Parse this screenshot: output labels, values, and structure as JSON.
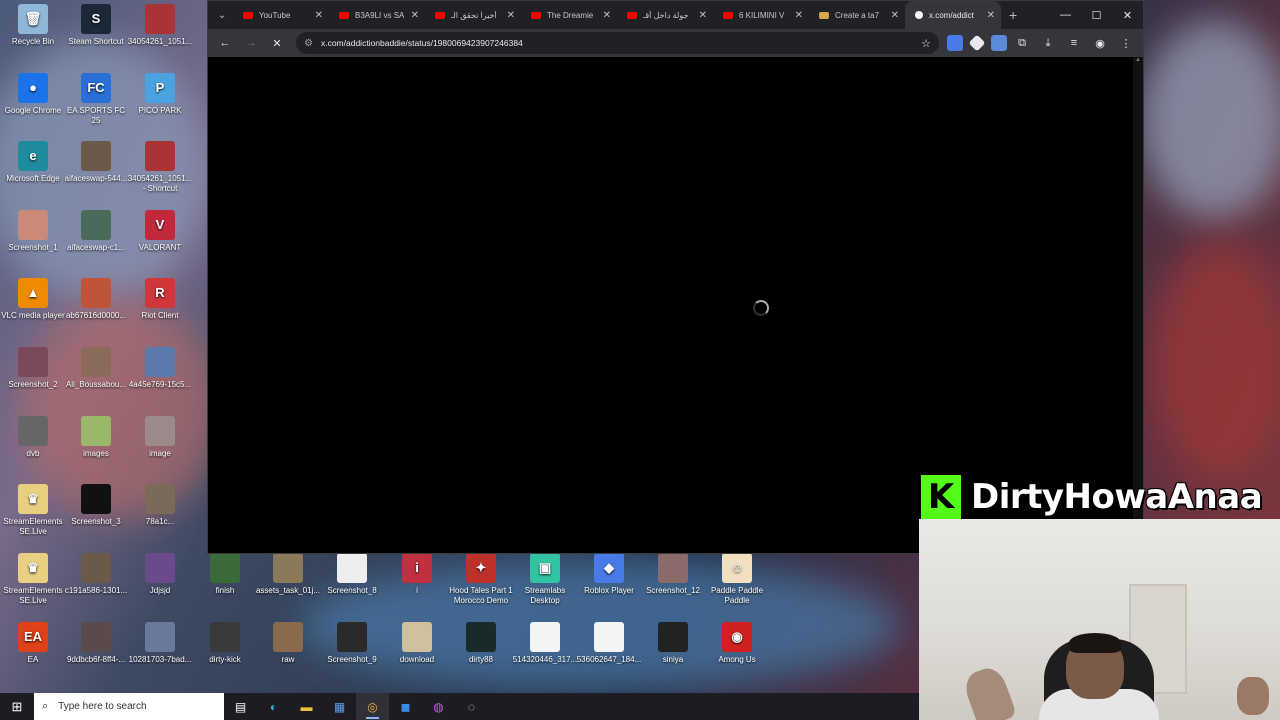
{
  "browser": {
    "tabs": [
      {
        "title": "YouTube",
        "favicon": "youtube-icon"
      },
      {
        "title": "B3A9LI vs SA",
        "favicon": "youtube-icon"
      },
      {
        "title": "أخيراً تحقق الـ",
        "favicon": "youtube-icon"
      },
      {
        "title": "The Dreamie",
        "favicon": "youtube-icon"
      },
      {
        "title": "جولة داخل أقـ",
        "favicon": "youtube-icon"
      },
      {
        "title": "6 KILIMINI V",
        "favicon": "youtube-icon"
      },
      {
        "title": "Create a ta7",
        "favicon": "generic-icon"
      },
      {
        "title": "x.com/addict",
        "favicon": "x-icon",
        "active": true
      }
    ],
    "url": "x.com/addictionbaddie/status/1980069423907246384"
  },
  "desktop_icons": [
    {
      "label": "Recycle Bin",
      "color": "#8fb7d8",
      "glyph": "🗑"
    },
    {
      "label": "Steam Shortcut",
      "color": "#1b2838",
      "glyph": "S"
    },
    {
      "label": "34054261_1051...",
      "color": "#a33",
      "glyph": ""
    },
    {
      "label": "Google Chrome",
      "color": "#1a73e8",
      "glyph": "●"
    },
    {
      "label": "EA SPORTS FC 25",
      "color": "#2a6fd8",
      "glyph": "FC"
    },
    {
      "label": "PICO PARK",
      "color": "#4aa3df",
      "glyph": "P"
    },
    {
      "label": "Microsoft Edge",
      "color": "#1e8c9e",
      "glyph": "e"
    },
    {
      "label": "aifaceswap-544...",
      "color": "#6b5a4a",
      "glyph": ""
    },
    {
      "label": "34054261_1051... - Shortcut",
      "color": "#a33",
      "glyph": ""
    },
    {
      "label": "Screenshot_1",
      "color": "#c98a7a",
      "glyph": ""
    },
    {
      "label": "aifaceswap-c1...",
      "color": "#4a6a5a",
      "glyph": ""
    },
    {
      "label": "VALORANT",
      "color": "#c2283b",
      "glyph": "V"
    },
    {
      "label": "VLC media player",
      "color": "#f08a00",
      "glyph": "▲"
    },
    {
      "label": "ab67616d0000...",
      "color": "#c0543a",
      "glyph": ""
    },
    {
      "label": "Riot Client",
      "color": "#d1363a",
      "glyph": "R"
    },
    {
      "label": "Screenshot_2",
      "color": "#7a4a5a",
      "glyph": ""
    },
    {
      "label": "Ali_Boussabou...",
      "color": "#8a6a5a",
      "glyph": ""
    },
    {
      "label": "4a45e769-15c5...",
      "color": "#5a7aaa",
      "glyph": ""
    },
    {
      "label": "dvb",
      "color": "#666",
      "glyph": ""
    },
    {
      "label": "images",
      "color": "#9ab86a",
      "glyph": ""
    },
    {
      "label": "image",
      "color": "#9a8a8a",
      "glyph": ""
    },
    {
      "label": "StreamElements SE.Live",
      "color": "#e8d080",
      "glyph": "♛"
    },
    {
      "label": "Screenshot_3",
      "color": "#111",
      "glyph": ""
    },
    {
      "label": "78a1c...",
      "color": "#7a6a5a",
      "glyph": ""
    },
    {
      "label": "StreamElements SE.Live",
      "color": "#e8d080",
      "glyph": "♛"
    },
    {
      "label": "c191a586-1301...",
      "color": "#6a5a4a",
      "glyph": ""
    },
    {
      "label": "Jdjsjd",
      "color": "#6a4a8a",
      "glyph": ""
    },
    {
      "label": "finish",
      "color": "#3a6a3a",
      "glyph": ""
    },
    {
      "label": "assets_task_01j...",
      "color": "#8a7a5a",
      "glyph": ""
    },
    {
      "label": "Screenshot_8",
      "color": "#eee",
      "glyph": ""
    },
    {
      "label": "i",
      "color": "#c03040",
      "glyph": "i"
    },
    {
      "label": "Hood Tales Part 1 Morocco Demo",
      "color": "#c0302a",
      "glyph": "✦"
    },
    {
      "label": "Streamlabs Desktop",
      "color": "#31c3a2",
      "glyph": "▣"
    },
    {
      "label": "Roblox Player",
      "color": "#4a7ae8",
      "glyph": "◆"
    },
    {
      "label": "Screenshot_12",
      "color": "#8a6a6a",
      "glyph": ""
    },
    {
      "label": "Paddle Paddle Paddle",
      "color": "#f0e0c0",
      "glyph": "☺"
    },
    {
      "label": "EA",
      "color": "#e0401a",
      "glyph": "EA"
    },
    {
      "label": "9ddbcb6f-8ff4-...",
      "color": "#5a4a4a",
      "glyph": ""
    },
    {
      "label": "10281703-7bad...",
      "color": "#6a7a9a",
      "glyph": ""
    },
    {
      "label": "dirty-kick",
      "color": "#3a3a3a",
      "glyph": ""
    },
    {
      "label": "raw",
      "color": "#8a6a4a",
      "glyph": ""
    },
    {
      "label": "Screenshot_9",
      "color": "#2a2a2a",
      "glyph": ""
    },
    {
      "label": "download",
      "color": "#d0c0a0",
      "glyph": ""
    },
    {
      "label": "dirty88",
      "color": "#1a2a2a",
      "glyph": ""
    },
    {
      "label": "514320446_317...",
      "color": "#f4f4f4",
      "glyph": ""
    },
    {
      "label": "536062647_184...",
      "color": "#f4f4f4",
      "glyph": ""
    },
    {
      "label": "siniya",
      "color": "#222",
      "glyph": ""
    },
    {
      "label": "Among Us",
      "color": "#d02020",
      "glyph": "◉"
    }
  ],
  "overlay": {
    "kick_logo": "K",
    "streamer_name": "DirtyHowaAnaa"
  },
  "taskbar": {
    "search_placeholder": "Type here to search"
  }
}
